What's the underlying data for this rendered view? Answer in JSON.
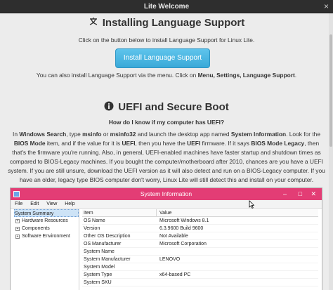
{
  "window": {
    "title": "Lite Welcome",
    "close_glyph": "×"
  },
  "language": {
    "heading": "Installing Language Support",
    "intro": "Click on the button below to install Language Support for Linux Lite.",
    "button": "Install Language Support",
    "note_prefix": "You can also install Language Support via the menu. Click on ",
    "note_path": "Menu, Settings, Language Support",
    "note_suffix": "."
  },
  "uefi": {
    "heading": "UEFI and Secure Boot",
    "question": "How do I know if my computer has UEFI?",
    "p1": "In ",
    "b1": "Windows Search",
    "p2": ", type ",
    "b2": "msinfo",
    "p3": " or ",
    "b3": "msinfo32",
    "p4": " and launch the desktop app named ",
    "b4": "System Information",
    "p5": ". Look for the ",
    "b5": "BIOS Mode",
    "p6": " item, and if the value for it is ",
    "b6": "UEFI",
    "p7": ", then you have the ",
    "b7": "UEFI",
    "p8": " firmware. If it says ",
    "b8": "BIOS Mode Legacy",
    "p9": ", then that's the firmware you're running. Also, in general, UEFI-enabled machines have faster startup and shutdown times as compared to BIOS-Legacy machines. If you bought the computer/motherboard after 2010, chances are you have a UEFI system. If you are still unsure, download the UEFI version as it will also detect and run on a BIOS-Legacy computer. If you have an older, legacy type BIOS computer don't worry, Linux Lite will still detect this and install on your computer."
  },
  "sysinfo": {
    "title": "System Information",
    "menu": [
      "File",
      "Edit",
      "View",
      "Help"
    ],
    "tree": [
      "System Summary",
      "Hardware Resources",
      "Components",
      "Software Environment"
    ],
    "columns": [
      "Item",
      "Value"
    ],
    "rows": [
      [
        "OS Name",
        "Microsoft Windows 8.1"
      ],
      [
        "Version",
        "6.3.9600 Build 9600"
      ],
      [
        "Other OS Description",
        "Not Available"
      ],
      [
        "OS Manufacturer",
        "Microsoft Corporation"
      ],
      [
        "System Name",
        ""
      ],
      [
        "System Manufacturer",
        "LENOVO"
      ],
      [
        "System Model",
        ""
      ],
      [
        "System Type",
        "x64-based PC"
      ],
      [
        "System SKU",
        ""
      ]
    ]
  }
}
